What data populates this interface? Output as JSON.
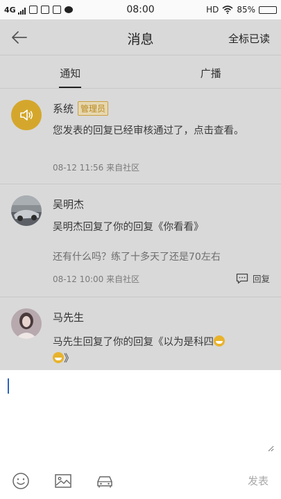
{
  "status_bar": {
    "network": "4G",
    "time": "08:00",
    "hd": "HD",
    "battery": "85%",
    "battery_level": 0.85
  },
  "header": {
    "title": "消息",
    "mark_all_read": "全标已读"
  },
  "tabs": [
    {
      "label": "通知",
      "active": true
    },
    {
      "label": "广播",
      "active": false
    }
  ],
  "messages": [
    {
      "sender": "系统",
      "badge": "管理员",
      "text": "您发表的回复已经审核通过了，点击查看。",
      "meta": "08-12 11:56 来自社区",
      "avatar_icon": "speaker-icon"
    },
    {
      "sender": "吴明杰",
      "text": "吴明杰回复了你的回复《你看看》",
      "quote": "还有什么吗？练了十多天了还是70左右",
      "meta": "08-12 10:00 来自社区",
      "reply_label": "回复"
    },
    {
      "sender": "马先生",
      "text_part1": "马先生回复了你的回复《以为是科四",
      "text_part2": "》"
    }
  ],
  "composer": {
    "submit_label": "发表",
    "tools": [
      "emoji-icon",
      "image-icon",
      "car-icon"
    ]
  },
  "colors": {
    "accent_gold": "#d4a72c",
    "overlay_gray": "#d9d9d9",
    "caret_blue": "#2e63b8"
  }
}
